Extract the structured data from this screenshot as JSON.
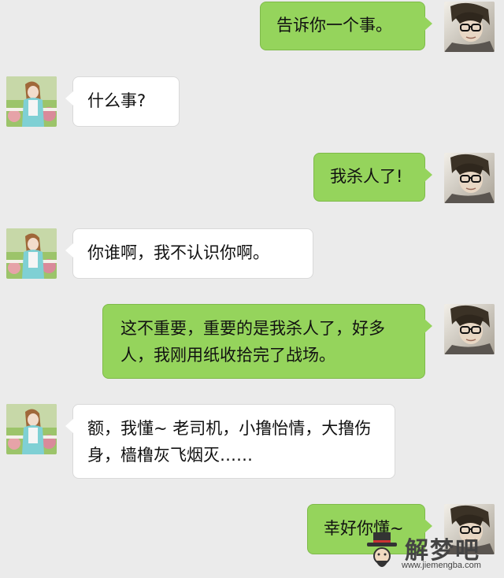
{
  "colors": {
    "background": "#ebebeb",
    "outgoing_bubble": "#95d45c",
    "incoming_bubble": "#ffffff"
  },
  "messages": [
    {
      "sender": "me",
      "text": "告诉你一个事。"
    },
    {
      "sender": "her",
      "text": "什么事?"
    },
    {
      "sender": "me",
      "text": "我杀人了!"
    },
    {
      "sender": "her",
      "text": "你谁啊，我不认识你啊。"
    },
    {
      "sender": "me",
      "text": "这不重要，重要的是我杀人了，好多人，我刚用纸收拾完了战场。"
    },
    {
      "sender": "her",
      "text": "额，我懂~ 老司机，小撸怡情，大撸伤身，樯橹灰飞烟灭……"
    },
    {
      "sender": "me",
      "text": "幸好你懂~"
    }
  ],
  "watermark": {
    "brand": "解梦吧",
    "url": "www.jiemengba.com"
  }
}
